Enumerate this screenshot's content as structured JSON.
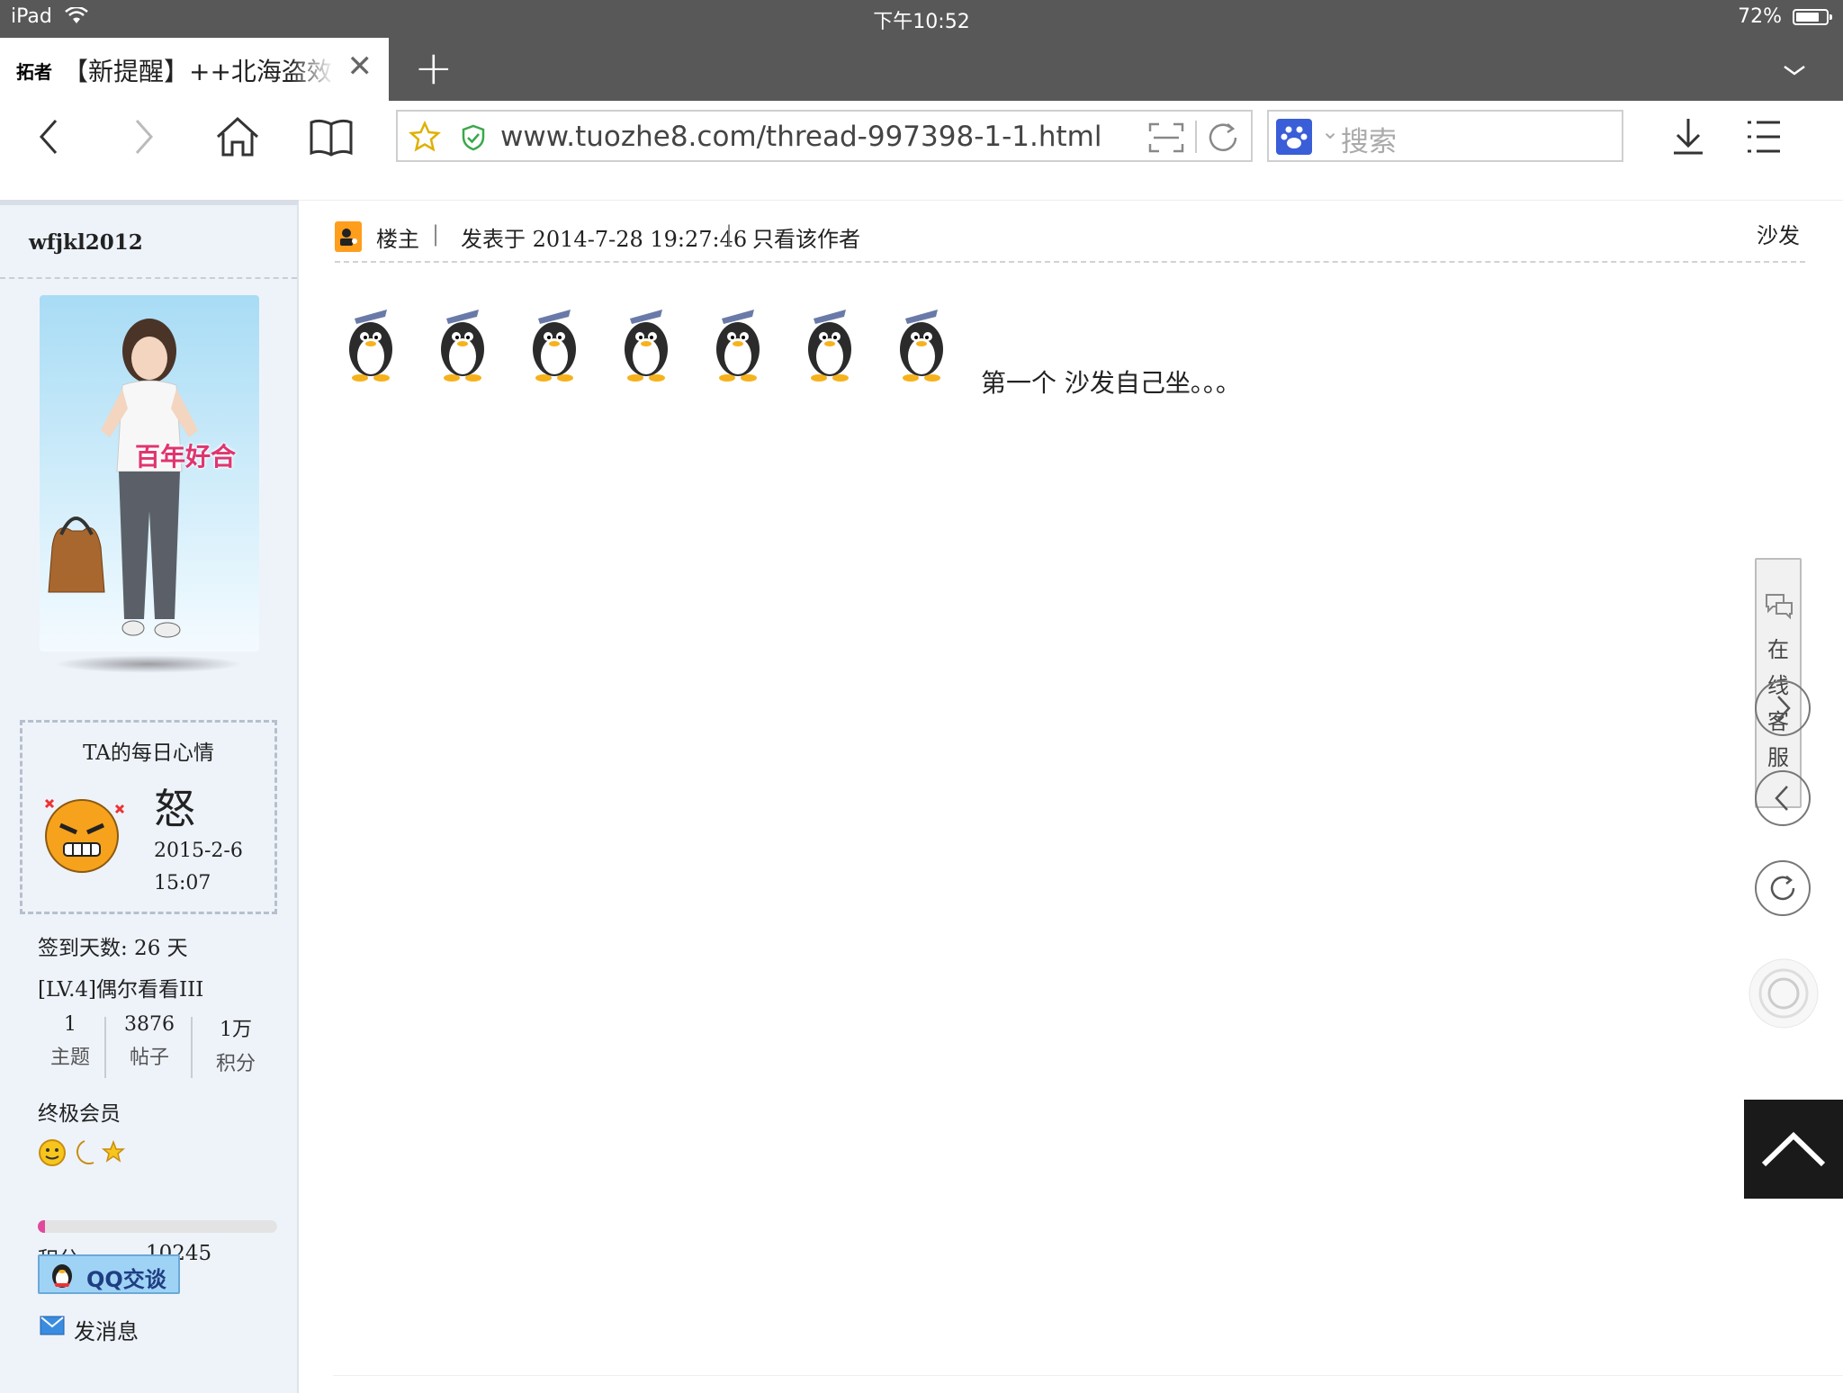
{
  "status_bar": {
    "device": "iPad",
    "time": "下午10:52",
    "battery": "72%",
    "battery_level": 0.72
  },
  "browser": {
    "tab_favicon": "拓者",
    "tab_title": "【新提醒】++北海盗效果",
    "url": "www.tuozhe8.com/thread-997398-1-1.html",
    "search_placeholder": "搜索"
  },
  "sidebar": {
    "username": "wfjkl2012",
    "avatar_caption": "百年好合",
    "mood": {
      "caption": "TA的每日心情",
      "word": "怒",
      "date": "2015-2-6",
      "time": "15:07"
    },
    "checkin": "签到天数: 26 天",
    "level": "[LV.4]偶尔看看III",
    "stats": [
      {
        "num": "1",
        "label": "主题"
      },
      {
        "num": "3876",
        "label": "帖子"
      },
      {
        "num": "1万",
        "label": "积分"
      }
    ],
    "member_group": "终极会员",
    "progress": 0.03,
    "points_label": "积分",
    "points_value": "10245",
    "qq_button": "QQ交谈",
    "message_link": "发消息"
  },
  "post": {
    "role": "楼主",
    "posted": "发表于 2014-7-28 19:27:46",
    "only_author": "只看该作者",
    "floor": "沙发",
    "text": "第一个 沙发自己坐。。。"
  },
  "right_panel": {
    "kefu_label": [
      "在",
      "线",
      "客",
      "服"
    ]
  },
  "colors": {
    "accent_pink": "#e04a9c",
    "qq_blue": "#9fd3f6",
    "baidu_blue": "#3a5ed8"
  }
}
